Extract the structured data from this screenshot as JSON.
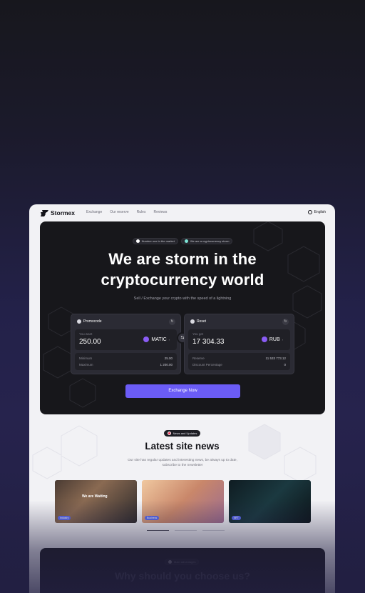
{
  "nav": {
    "brand": "Stormex",
    "links": [
      "Exchange",
      "Our reserve",
      "Rules",
      "Reviews"
    ],
    "language": "English"
  },
  "hero": {
    "badges": [
      "Number one in the market",
      "We are a cryptocurrency storm"
    ],
    "title_line1": "We are storm in the",
    "title_line2": "cryptocurrency world",
    "subtitle": "Sell / Exchange your crypto with the speed of a lightning",
    "cta": "Exchange Now"
  },
  "exchange": {
    "left": {
      "header": "Promocode",
      "label": "You want",
      "amount": "250.00",
      "currency": "MATIC",
      "stats": [
        {
          "label": "Minimum",
          "value": "25.00"
        },
        {
          "label": "Maximum",
          "value": "1 200.00"
        }
      ]
    },
    "right": {
      "header": "Reset",
      "label": "You get",
      "amount": "17 304.33",
      "currency": "RUB",
      "stats": [
        {
          "label": "Reserve",
          "value": "11 533 773.12"
        },
        {
          "label": "Discount Percentage",
          "value": "0"
        }
      ]
    },
    "swap_icon": "swap-arrows"
  },
  "news": {
    "badge": "News and Updates",
    "title": "Latest site news",
    "description": "Our site has regular updates and interesting news, be always up to date, subscribe to the newsletter",
    "cards": [
      {
        "tag": "Industry",
        "screen_text": "We are Waiting"
      },
      {
        "tag": "Business",
        "screen_text": ""
      },
      {
        "tag": "NFT",
        "screen_text": ""
      }
    ],
    "carousel_pages": 3,
    "active_page": 1
  },
  "why": {
    "badge": "Main advantages",
    "title": "Why should you choose us?"
  },
  "colors": {
    "accent": "#6b5cf6",
    "hero_bg": "#17171b",
    "card_bg": "#f2f2f5",
    "page_bg_bottom": "#26234d"
  }
}
